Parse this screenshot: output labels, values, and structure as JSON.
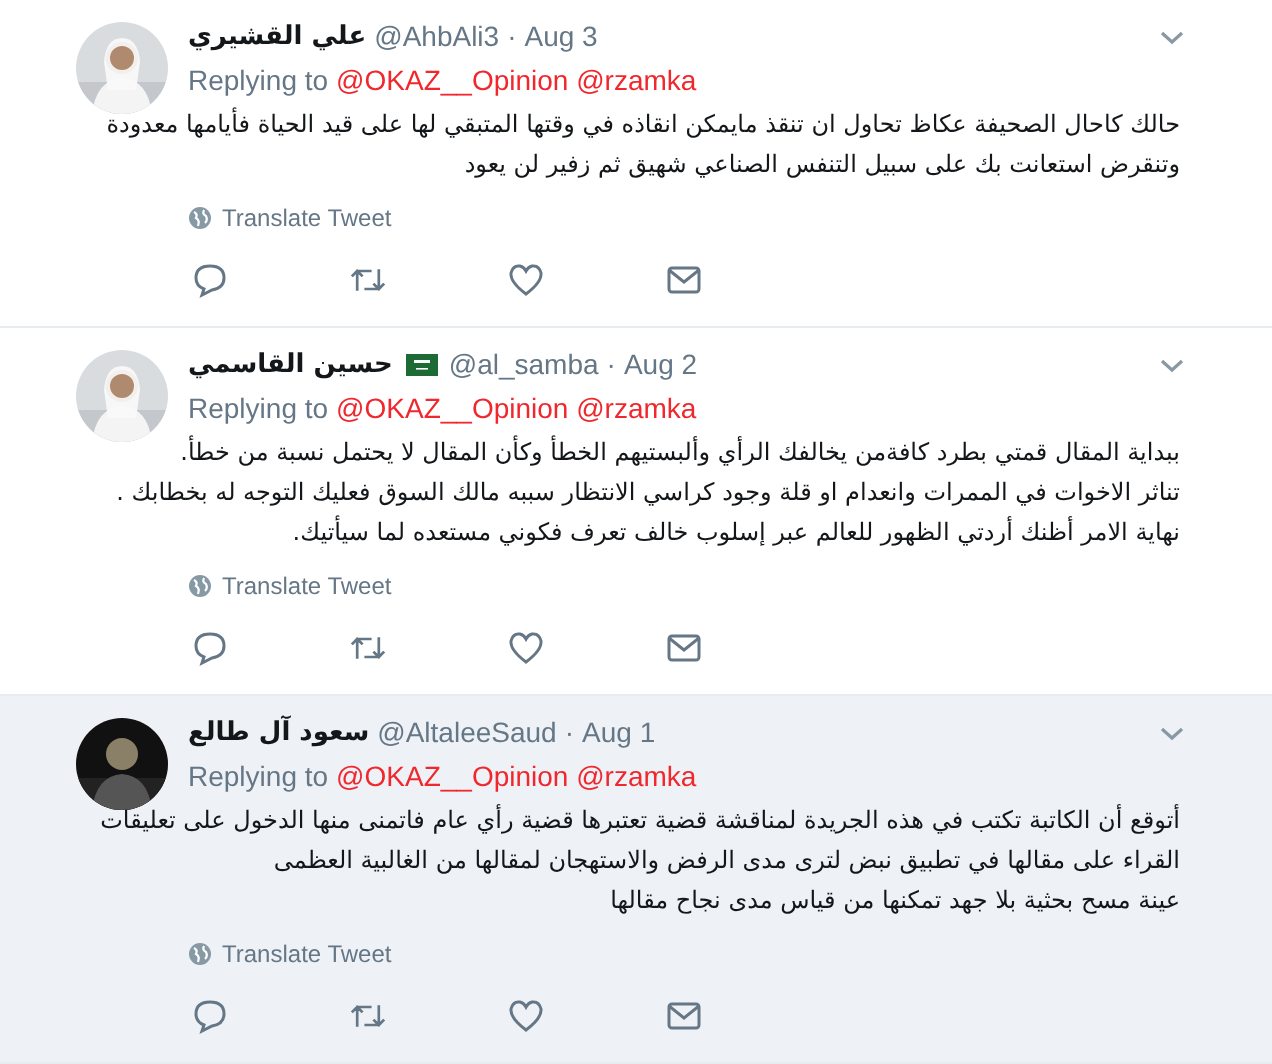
{
  "tweets": [
    {
      "name": "علي القشيري",
      "flag": false,
      "handle": "@AhbAli3",
      "separator": "·",
      "date": "Aug 3",
      "highlighted": false,
      "replying_label": "Replying to",
      "replying_to": "@OKAZ__Opinion @rzamka",
      "body": [
        "حالك كاحال الصحيفة عكاظ تحاول ان تنقذ مايمكن انقاذه في وقتها المتبقي لها على قيد الحياة فأيامها معدودة",
        "وتنقرض  استعانت بك على سبيل التنفس الصناعي شهيق ثم زفير لن يعود"
      ],
      "translate": "Translate Tweet"
    },
    {
      "name": "حسين القاسمي",
      "flag": true,
      "handle": "@al_samba",
      "separator": "·",
      "date": "Aug 2",
      "highlighted": false,
      "replying_label": "Replying to",
      "replying_to": "@OKAZ__Opinion @rzamka",
      "body": [
        "ببداية المقال قمتي بطرد كافةمن يخالفك الرأي وألبستيهم الخطأ وكأن المقال لا يحتمل نسبة من خطأ.",
        "تناثر الاخوات في الممرات وانعدام او قلة وجود كراسي الانتظار سببه مالك السوق فعليك التوجه له بخطابك .",
        "نهاية الامر أظنك أردتي الظهور للعالم عبر إسلوب خالف تعرف فكوني مستعده لما سيأتيك."
      ],
      "translate": "Translate Tweet"
    },
    {
      "name": "سعود آل طالع",
      "flag": false,
      "handle": "@AltaleeSaud",
      "separator": "·",
      "date": "Aug 1",
      "highlighted": true,
      "replying_label": "Replying to",
      "replying_to": "@OKAZ__Opinion @rzamka",
      "body": [
        "أتوقع أن الكاتبة تكتب في هذه الجريدة لمناقشة قضية تعتبرها قضية رأي عام فاتمنى منها الدخول على تعليقات",
        "القراء على مقالها في تطبيق نبض لترى مدى الرفض والاستهجان لمقالها من الغالبية العظمى",
        "عينة مسح بحثية بلا جهد تمكنها من قياس مدى نجاح مقالها"
      ],
      "translate": "Translate Tweet"
    }
  ]
}
